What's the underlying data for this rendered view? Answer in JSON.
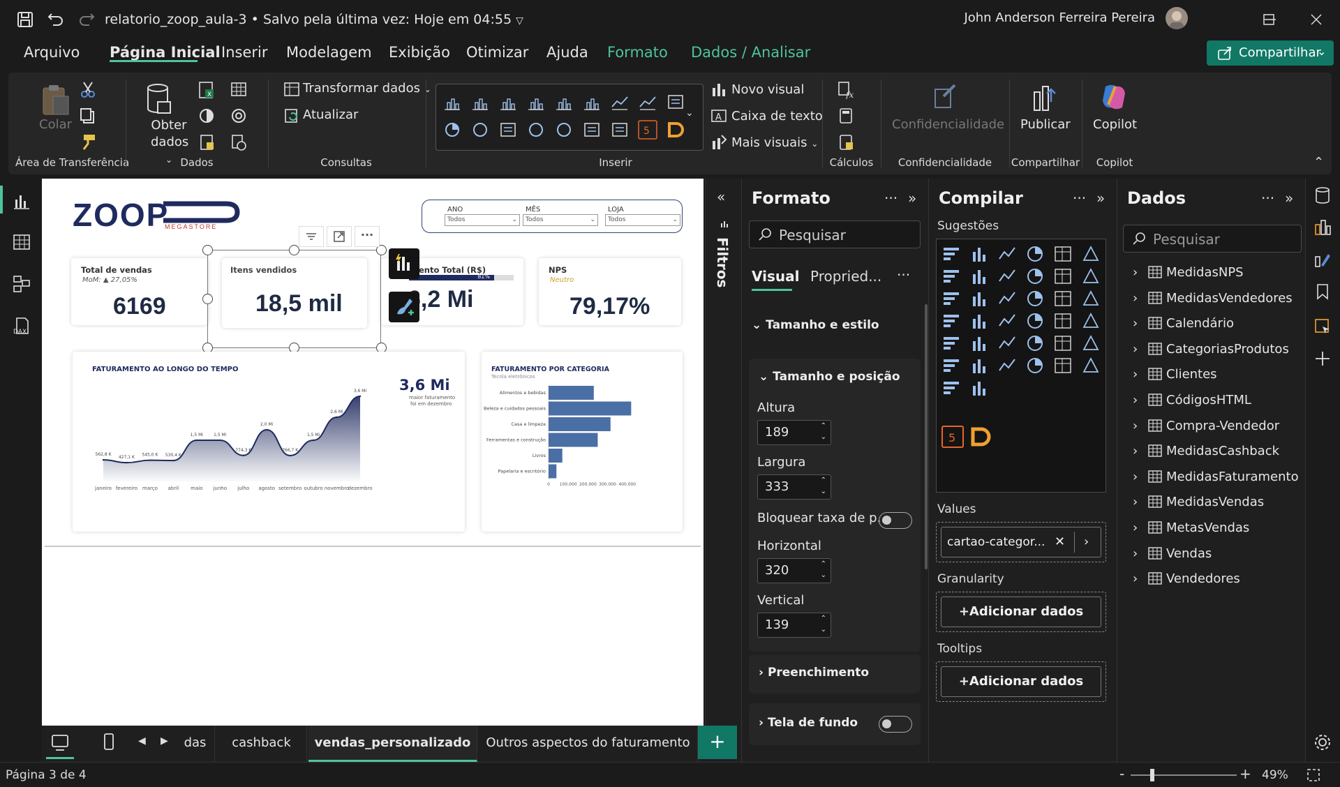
{
  "titlebar": {
    "file_name": "relatorio_zoop_aula-3",
    "saved_status": "Salvo pela última vez: Hoje em 04:55",
    "user_name": "John Anderson Ferreira Pereira"
  },
  "menu": {
    "items": [
      "Arquivo",
      "Página Inicial",
      "Inserir",
      "Modelagem",
      "Exibição",
      "Otimizar",
      "Ajuda",
      "Formato",
      "Dados / Analisar"
    ],
    "active": "Página Inicial",
    "share_label": "Compartilhar"
  },
  "ribbon": {
    "clipboard": {
      "paste": "Colar",
      "group": "Área de Transferência"
    },
    "data": {
      "get_data": "Obter dados",
      "group": "Dados"
    },
    "queries": {
      "transform": "Transformar dados",
      "refresh": "Atualizar",
      "group": "Consultas"
    },
    "insert": {
      "new_visual": "Novo visual",
      "text_box": "Caixa de texto",
      "more_visuals": "Mais visuais",
      "group": "Inserir"
    },
    "calculations": {
      "group": "Cálculos"
    },
    "sensitivity": {
      "button": "Confidencialidade",
      "group": "Confidencialidade"
    },
    "share": {
      "publish": "Publicar",
      "group": "Compartilhar"
    },
    "copilot": {
      "button": "Copilot",
      "group": "Copilot"
    }
  },
  "report": {
    "logo_text": "ZOOP",
    "logo_sub": "MEGASTORE",
    "slicers": [
      {
        "label": "ANO",
        "value": "Todos"
      },
      {
        "label": "MÊS",
        "value": "Todos"
      },
      {
        "label": "LOJA",
        "value": "Todos"
      }
    ],
    "cards": [
      {
        "title": "Total de vendas",
        "subtitle": "MoM: ▲ 27,05%",
        "value": "6169"
      },
      {
        "title": "Itens vendidos",
        "value": "18,5 mil"
      },
      {
        "title": "mento Total (R$)",
        "progress_label": "81%",
        "value": "6,2 Mi"
      },
      {
        "title": "NPS",
        "subtitle": "Neutro",
        "value": "79,17%"
      }
    ],
    "line_chart": {
      "title": "FATURAMENTO AO LONGO DO TEMPO",
      "callout_value": "3,6 Mi",
      "callout_text_1": "maior faturamento",
      "callout_text_2": "foi em dezembro"
    },
    "bar_chart": {
      "title": "FATURAMENTO POR CATEGORIA",
      "subtitle": "Tecnla eletrônicos"
    }
  },
  "chart_data": [
    {
      "type": "area",
      "title": "FATURAMENTO AO LONGO DO TEMPO",
      "categories": [
        "janeiro",
        "fevereiro",
        "março",
        "abril",
        "maio",
        "junho",
        "julho",
        "agosto",
        "setembro",
        "outubro",
        "novembro",
        "dezembro"
      ],
      "values": [
        562.8,
        427.1,
        545.0,
        530.4,
        1500,
        1500,
        774.3,
        2000,
        766.7,
        1500,
        2600,
        3600
      ],
      "data_labels": [
        "562,8 K",
        "427,1 K",
        "545,0 K",
        "530,4 K",
        "1,5 Mi",
        "1,5 Mi",
        "774,3 K",
        "2,0 Mi",
        "766,7 K",
        "1,5 Mi",
        "2,6 Mi",
        "3,6 Mi"
      ],
      "color": "#1f2a5e"
    },
    {
      "type": "bar",
      "title": "FATURAMENTO POR CATEGORIA",
      "categories": [
        "Alimentos e bebidas",
        "Beleza e cuidados pessoais",
        "Casa e limpeza",
        "Ferramentas e construção",
        "Livros",
        "Papelaria e escritório"
      ],
      "values": [
        230000,
        420000,
        315000,
        250000,
        70000,
        40000
      ],
      "x_ticks": [
        "0",
        "100.000",
        "200.000",
        "300.000",
        "400.000"
      ],
      "xlim": [
        0,
        440000
      ],
      "color": "#4a6fa5"
    }
  ],
  "filters": {
    "label": "Filtros"
  },
  "format_pane": {
    "title": "Formato",
    "search_placeholder": "Pesquisar",
    "tabs": [
      "Visual",
      "Propried..."
    ],
    "section_size_style": "Tamanho e estilo",
    "section_size_position": "Tamanho e posição",
    "height_label": "Altura",
    "height_value": "189",
    "width_label": "Largura",
    "width_value": "333",
    "lock_label": "Bloquear taxa de p...",
    "horizontal_label": "Horizontal",
    "horizontal_value": "320",
    "vertical_label": "Vertical",
    "vertical_value": "139",
    "fill": "Preenchimento",
    "background": "Tela de fundo"
  },
  "build_pane": {
    "title": "Compilar",
    "suggestions": "Sugestões",
    "values_label": "Values",
    "values_field": "cartao-categor...",
    "granularity_label": "Granularity",
    "add_data": "+Adicionar dados",
    "tooltips_label": "Tooltips"
  },
  "data_pane": {
    "title": "Dados",
    "search_placeholder": "Pesquisar",
    "tables": [
      "MedidasNPS",
      "MedidasVendedores",
      "Calendário",
      "CategoriasProdutos",
      "Clientes",
      "CódigosHTML",
      "Compra-Vendedor",
      "MedidasCashback",
      "MedidasFaturamento",
      "MedidasVendas",
      "MetasVendas",
      "Vendas",
      "Vendedores"
    ]
  },
  "tabs": {
    "items": [
      "das",
      "cashback",
      "vendas_personalizado",
      "Outros aspectos do faturamento"
    ],
    "active": "vendas_personalizado"
  },
  "status": {
    "page": "Página 3 de 4",
    "zoom": "49%"
  },
  "colors": {
    "accent": "#4ec49a",
    "share": "#117865",
    "navy": "#1f2a44"
  }
}
